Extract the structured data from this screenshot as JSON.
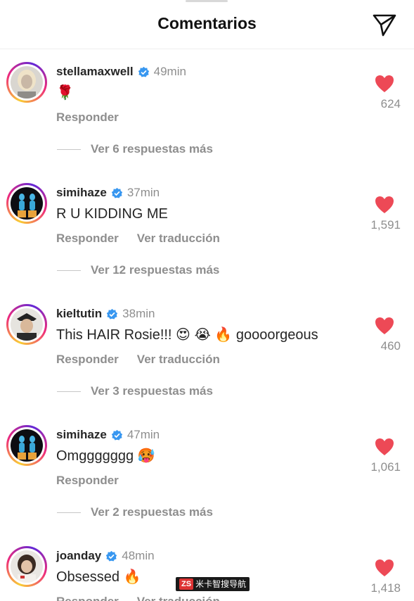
{
  "header": {
    "title": "Comentarios",
    "send_icon": "paper-plane-icon"
  },
  "colors": {
    "like": "#ed4956",
    "verified": "#3897f0",
    "muted": "#8e8e8e"
  },
  "comments": [
    {
      "username": "stellamaxwell",
      "time": "49min",
      "text": "🌹",
      "reply_label": "Responder",
      "translate_label": "",
      "replies": "Ver 6 respuestas más",
      "likes": "624"
    },
    {
      "username": "simihaze",
      "time": "37min",
      "text": "R U KIDDING ME",
      "reply_label": "Responder",
      "translate_label": "Ver traducción",
      "replies": "Ver 12 respuestas más",
      "likes": "1,591"
    },
    {
      "username": "kieltutin",
      "time": "38min",
      "text": "This HAIR Rosie!!! 😍 😭 🔥 goooorgeous",
      "reply_label": "Responder",
      "translate_label": "Ver traducción",
      "replies": "Ver 3 respuestas más",
      "likes": "460"
    },
    {
      "username": "simihaze",
      "time": "47min",
      "text": "Omggggggg 🥵",
      "reply_label": "Responder",
      "translate_label": "",
      "replies": "Ver 2 respuestas más",
      "likes": "1,061"
    },
    {
      "username": "joanday",
      "time": "48min",
      "text": "Obsessed 🔥",
      "reply_label": "Responder",
      "translate_label": "Ver traducción",
      "replies": "",
      "likes": "1,418"
    }
  ],
  "watermark": {
    "logo": "ZS",
    "text": "米卡智搜导航"
  }
}
